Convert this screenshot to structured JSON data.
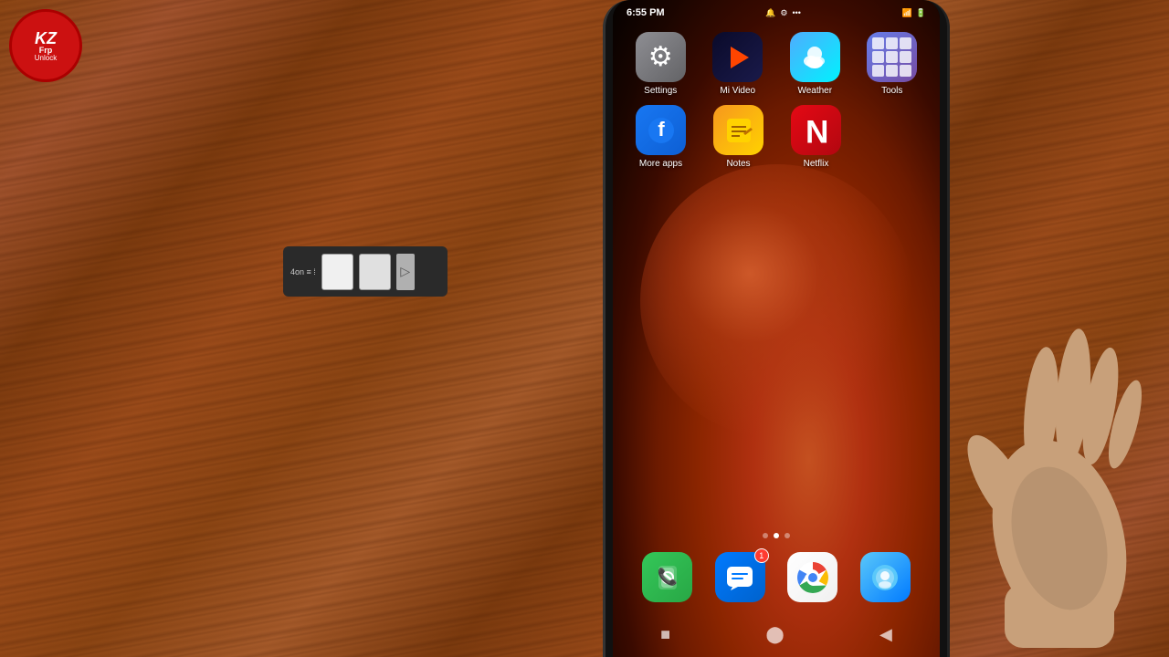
{
  "logo": {
    "kz": "KZ",
    "frp": "Frp",
    "unlock": "Unlock"
  },
  "status_bar": {
    "time": "6:55 PM",
    "center_icons": [
      "🔔",
      "⚙",
      "•••"
    ],
    "right_icons": [
      "📶",
      "🔋"
    ]
  },
  "apps": {
    "row1": [
      {
        "id": "settings",
        "label": "Settings",
        "type": "settings"
      },
      {
        "id": "mi-video",
        "label": "Mi Video",
        "type": "mivideo"
      },
      {
        "id": "weather",
        "label": "Weather",
        "type": "weather"
      },
      {
        "id": "tools",
        "label": "Tools",
        "type": "tools"
      }
    ],
    "row2": [
      {
        "id": "more-apps",
        "label": "More apps",
        "type": "moreapps"
      },
      {
        "id": "notes",
        "label": "Notes",
        "type": "notes"
      },
      {
        "id": "netflix",
        "label": "Netflix",
        "type": "netflix"
      }
    ]
  },
  "dock": [
    {
      "id": "phone",
      "label": "Phone",
      "type": "phone"
    },
    {
      "id": "messages",
      "label": "Messages",
      "type": "messages",
      "badge": "1"
    },
    {
      "id": "chrome",
      "label": "Chrome",
      "type": "chrome"
    },
    {
      "id": "security",
      "label": "Security",
      "type": "security"
    }
  ],
  "page_dots": [
    {
      "active": false
    },
    {
      "active": true
    },
    {
      "active": false
    }
  ],
  "nav": {
    "back": "◀",
    "home": "⬤",
    "recents": "■"
  },
  "sim_tray": {
    "text": "4on"
  }
}
